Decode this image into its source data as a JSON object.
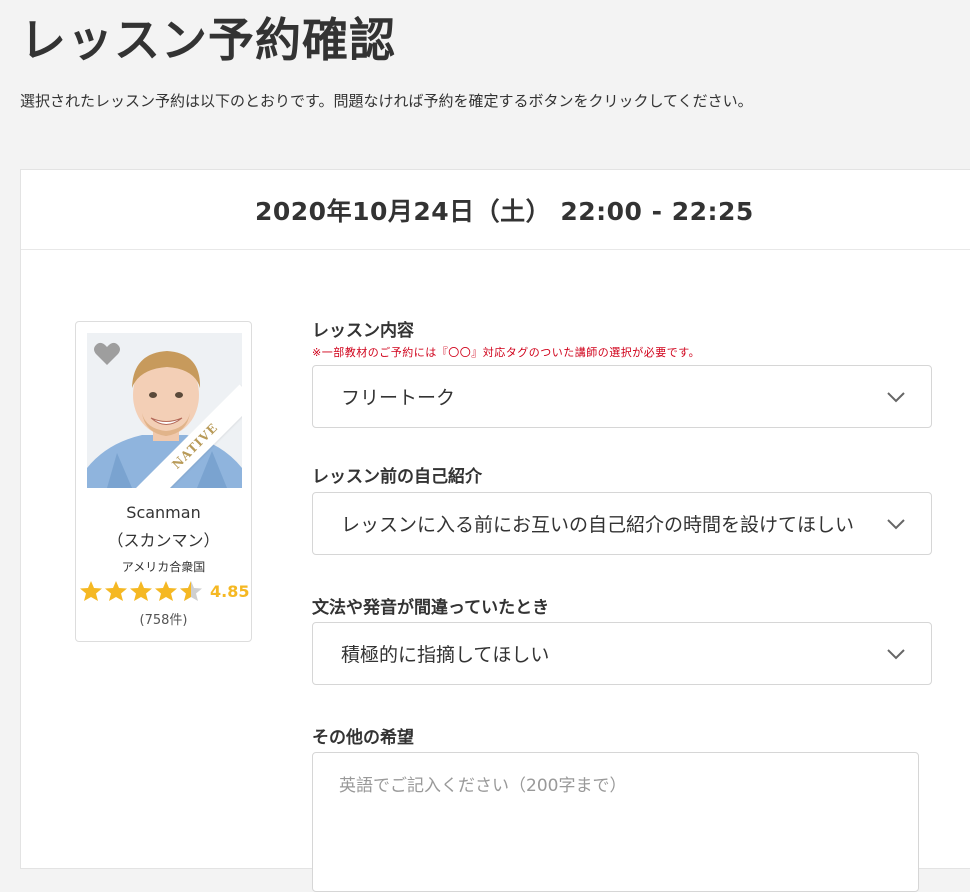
{
  "page": {
    "title": "レッスン予約確認",
    "intro": "選択されたレッスン予約は以下のとおりです。問題なければ予約を確定するボタンをクリックしてください。"
  },
  "lesson": {
    "datetime": "2020年10月24日（土） 22:00 - 22:25"
  },
  "teacher": {
    "name": "Scanman",
    "kana": "（スカンマン）",
    "country": "アメリカ合衆国",
    "badge": "NATIVE",
    "rating": 4.85,
    "rating_text": "4.85",
    "reviews": "(758件)",
    "favorite_icon": "heart-icon",
    "star_color": "#f5b823"
  },
  "form": {
    "lesson_content": {
      "label": "レッスン内容",
      "note": "※一部教材のご予約には『〇〇』対応タグのついた講師の選択が必要です。",
      "value": "フリートーク"
    },
    "self_intro": {
      "label": "レッスン前の自己紹介",
      "value": "レッスンに入る前にお互いの自己紹介の時間を設けてほしい"
    },
    "correction": {
      "label": "文法や発音が間違っていたとき",
      "value": "積極的に指摘してほしい"
    },
    "other_request": {
      "label": "その他の希望",
      "placeholder": "英語でご記入ください（200字まで）"
    }
  },
  "colors": {
    "note_red": "#d0021b",
    "star_gold": "#f5b823",
    "badge_gold": "#b89a58"
  }
}
